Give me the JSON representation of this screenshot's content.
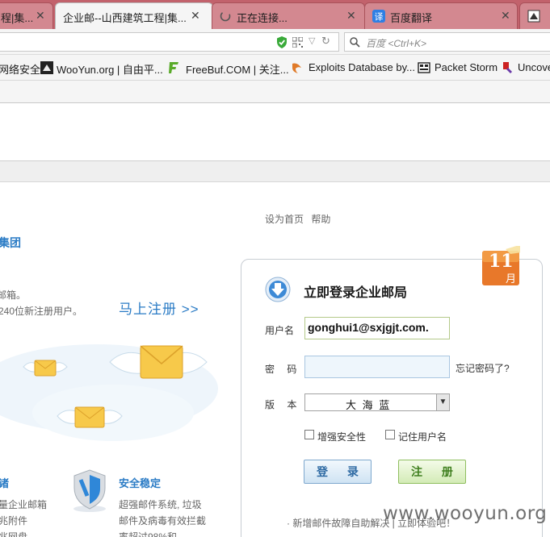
{
  "browser": {
    "tabs": [
      {
        "title": "程|集...",
        "active": false
      },
      {
        "title": "企业邮--山西建筑工程|集...",
        "active": true
      },
      {
        "title": "正在连接...",
        "active": false
      },
      {
        "title": "百度翻译",
        "active": false
      }
    ],
    "search_placeholder": "百度 <Ctrl+K>",
    "bookmarks": [
      {
        "label": "网络安全"
      },
      {
        "label": "WooYun.org | 自由平..."
      },
      {
        "label": "FreeBuf.COM | 关注..."
      },
      {
        "label": "Exploits Database by..."
      },
      {
        "label": "Packet Storm"
      },
      {
        "label": "Uncove"
      }
    ]
  },
  "page": {
    "topnav": [
      "设为首页",
      "帮助"
    ],
    "brand": "集团",
    "promo_line1": "邮箱。",
    "promo_line2": "240位新注册用户。",
    "signup": "马上注册 >>",
    "calendar": {
      "number": "11",
      "unit": "月"
    },
    "login": {
      "title": "立即登录企业邮局",
      "username_label": "用户名",
      "username_value": "gonghui1@sxjgjt.com.",
      "password_label": "密 码",
      "forgot": "忘记密码了?",
      "version_label": "版 本",
      "version_value": "大 海 蓝",
      "security_label": "增强安全性",
      "remember_label": "记住用户名",
      "login_button": "登 录",
      "register_button": "注 册",
      "news": "· 新增邮件故障自助解决 | 立即体验吧！"
    },
    "feature1": {
      "title": "诸",
      "lines": [
        "量企业邮箱",
        "兆附件",
        "兆网盘"
      ]
    },
    "feature2": {
      "title": "安全稳定",
      "lines": [
        "超强邮件系统, 垃圾",
        "邮件及病毒有效拦截",
        "率超过98%和"
      ]
    },
    "watermark": "www.wooyun.org"
  },
  "colors": {
    "tab_strip": "#c2626c",
    "brand_blue": "#2a7bc5",
    "calendar_orange": "#e8782a"
  }
}
